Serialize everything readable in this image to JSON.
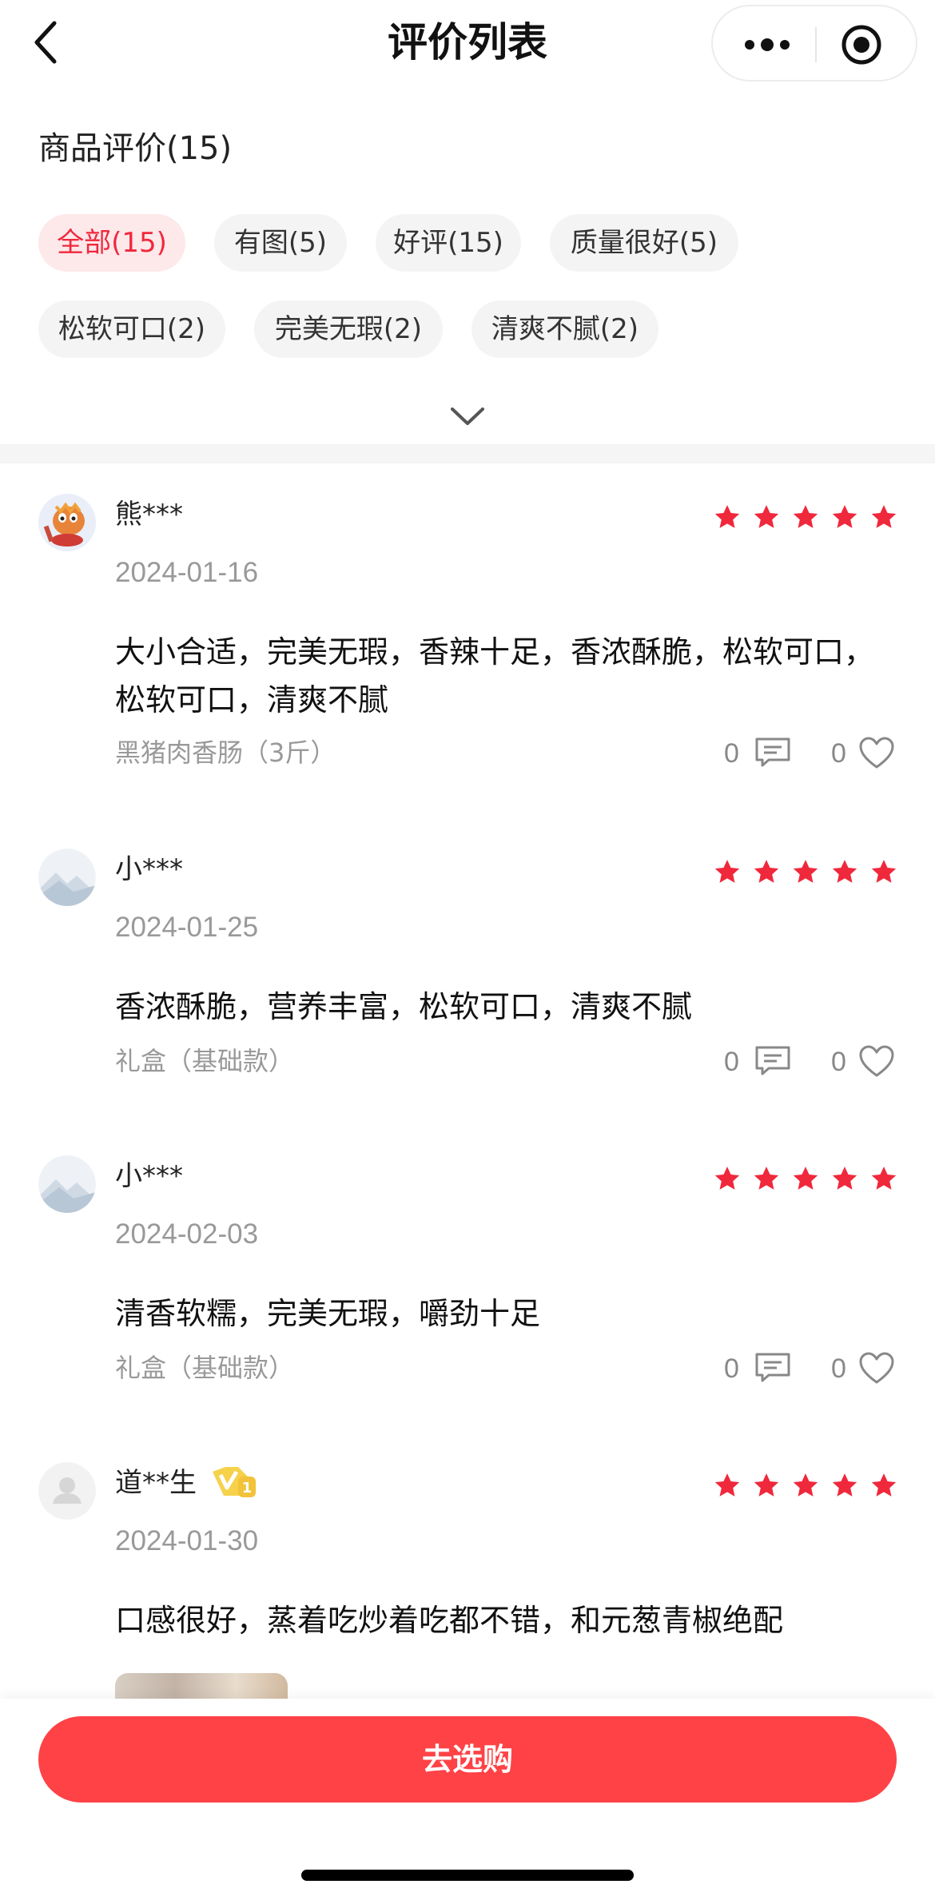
{
  "header": {
    "title": "评价列表"
  },
  "section": {
    "title": "商品评价(15)"
  },
  "filters": [
    {
      "label": "全部(15)",
      "active": true
    },
    {
      "label": "有图(5)",
      "active": false
    },
    {
      "label": "好评(15)",
      "active": false
    },
    {
      "label": "质量很好(5)",
      "active": false
    },
    {
      "label": "松软可口(2)",
      "active": false
    },
    {
      "label": "完美无瑕(2)",
      "active": false
    },
    {
      "label": "清爽不腻(2)",
      "active": false
    }
  ],
  "colors": {
    "accent": "#f0283c",
    "star": "#f0283c",
    "buy_button": "#ff4246"
  },
  "reviews": [
    {
      "user": "熊***",
      "avatar": "cartoon-avatar",
      "rating": 5,
      "date": "2024-01-16",
      "text": "大小合适，完美无瑕，香辣十足，香浓酥脆，松软可口，松软可口，清爽不腻",
      "spec": "黑猪肉香肠（3斤）",
      "comments": "0",
      "likes": "0"
    },
    {
      "user": "小***",
      "avatar": "mountain-avatar",
      "rating": 5,
      "date": "2024-01-25",
      "text": "香浓酥脆，营养丰富，松软可口，清爽不腻",
      "spec": "礼盒（基础款）",
      "comments": "0",
      "likes": "0"
    },
    {
      "user": "小***",
      "avatar": "mountain-avatar",
      "rating": 5,
      "date": "2024-02-03",
      "text": "清香软糯，完美无瑕，嚼劲十足",
      "spec": "礼盒（基础款）",
      "comments": "0",
      "likes": "0"
    },
    {
      "user": "道**生",
      "avatar": "default-avatar",
      "rating": 5,
      "vip_badge": "V1",
      "date": "2024-01-30",
      "text": "口感很好，蒸着吃炒着吃都不错，和元葱青椒绝配"
    }
  ],
  "bottom": {
    "buy_label": "去选购"
  }
}
